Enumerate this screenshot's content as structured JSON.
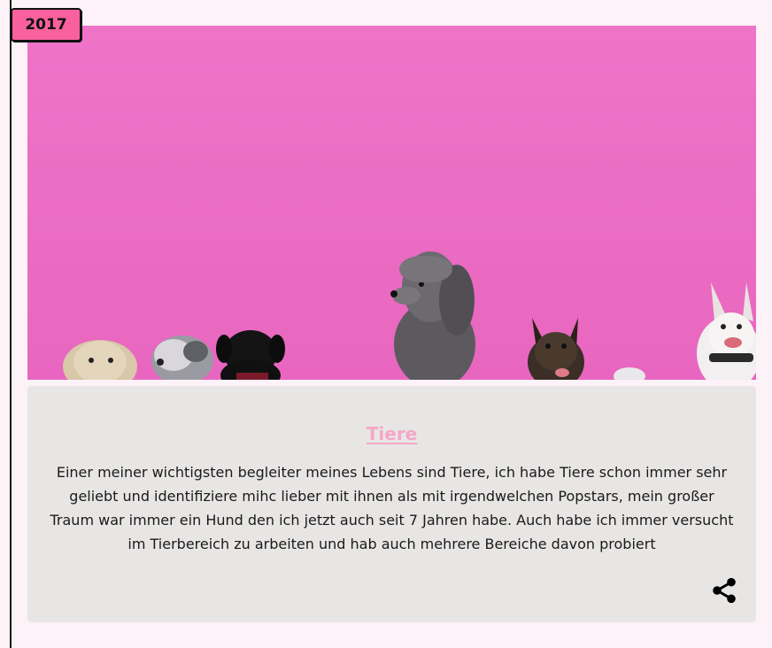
{
  "timeline": {
    "year": "2017"
  },
  "entry": {
    "image_alt": "Hunde vor einer pinken Wand",
    "title": "Tiere",
    "text": "Einer meiner wichtigsten begleiter meines Lebens sind Tiere, ich habe Tiere schon immer sehr geliebt und identifiziere mihc lieber mit ihnen als mit irgendwelchen Popstars, mein großer Traum war immer ein Hund den ich jetzt auch seit 7 Jahren habe. Auch habe ich immer versucht im Tierbereich zu arbeiten und hab auch mehrere Bereiche davon probiert",
    "share_icon": "share-icon"
  },
  "colors": {
    "page_background": "#fdf2f7",
    "badge_background": "#f8609e",
    "card_background": "#e8e6e5",
    "title_color": "#f4a7c6",
    "wall_color": "#ec6ec6"
  }
}
